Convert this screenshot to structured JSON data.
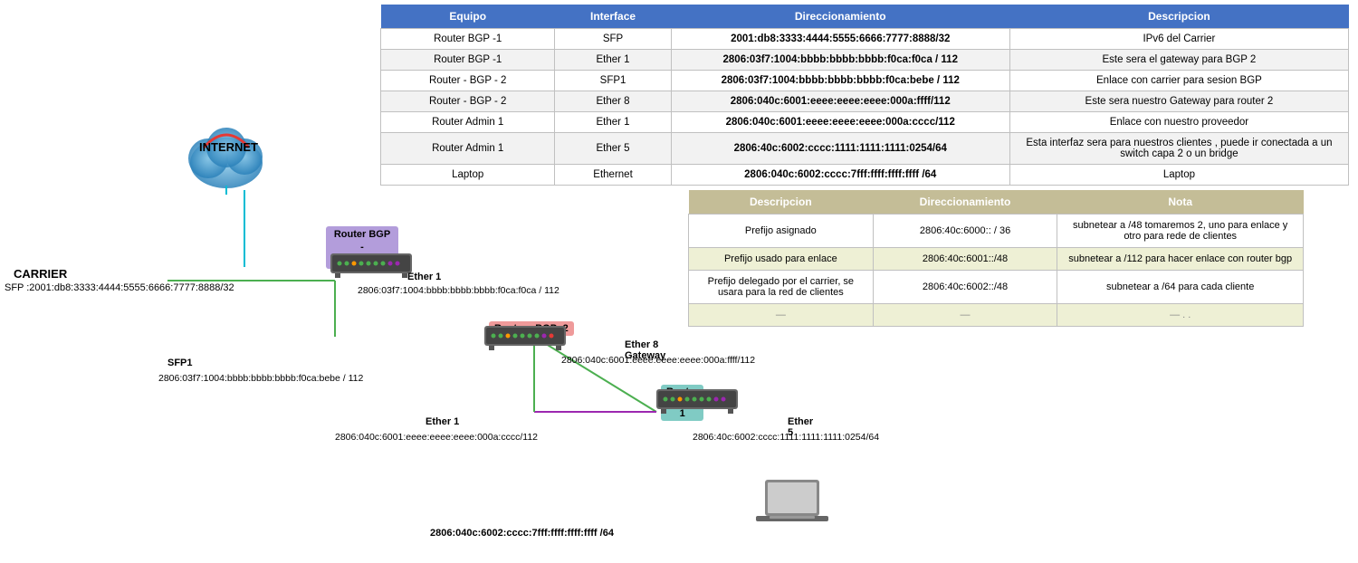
{
  "table": {
    "headers": [
      "Equipo",
      "Interface",
      "Direccionamiento",
      "Descripcion"
    ],
    "rows": [
      {
        "equipo": "Router BGP -1",
        "interface": "SFP",
        "direccionamiento": "2001:db8:3333:4444:5555:6666:7777:8888/32",
        "descripcion": "IPv6 del Carrier"
      },
      {
        "equipo": "Router BGP -1",
        "interface": "Ether 1",
        "direccionamiento": "2806:03f7:1004:bbbb:bbbb:bbbb:f0ca:f0ca / 112",
        "descripcion": "Este sera el gateway para BGP 2"
      },
      {
        "equipo": "Router - BGP - 2",
        "interface": "SFP1",
        "direccionamiento": "2806:03f7:1004:bbbb:bbbb:bbbb:f0ca:bebe / 112",
        "descripcion": "Enlace con carrier para sesion BGP"
      },
      {
        "equipo": "Router - BGP - 2",
        "interface": "Ether 8",
        "direccionamiento": "2806:040c:6001:eeee:eeee:eeee:000a:ffff/112",
        "descripcion": "Este sera nuestro Gateway para router 2"
      },
      {
        "equipo": "Router Admin 1",
        "interface": "Ether 1",
        "direccionamiento": "2806:040c:6001:eeee:eeee:eeee:000a:cccc/112",
        "descripcion": "Enlace con nuestro proveedor"
      },
      {
        "equipo": "Router Admin 1",
        "interface": "Ether 5",
        "direccionamiento": "2806:40c:6002:cccc:1111:1111:1111:0254/64",
        "descripcion": "Esta interfaz sera para nuestros clientes , puede ir conectada a un switch capa 2 o un bridge"
      },
      {
        "equipo": "Laptop",
        "interface": "Ethernet",
        "direccionamiento": "2806:040c:6002:cccc:7fff:ffff:ffff:ffff /64",
        "descripcion": "Laptop"
      }
    ]
  },
  "subtable": {
    "headers": [
      "Descripcion",
      "Direccionamiento",
      "Nota"
    ],
    "rows": [
      {
        "desc": "Prefijo asignado",
        "dir": "2806:40c:6000:: / 36",
        "nota": "subnetear a /48  tomaremos 2, uno para enlace y otro para rede de clientes"
      },
      {
        "desc": "Prefijo usado para enlace",
        "dir": "2806:40c:6001::/48",
        "nota": "subnetear a /112 para hacer enlace con router bgp"
      },
      {
        "desc": "Prefijo delegado por el carrier, se usara para la red de clientes",
        "dir": "2806:40c:6002::/48",
        "nota": "subnetear a /64 para cada cliente"
      },
      {
        "desc": "—",
        "dir": "—",
        "nota": "— . ."
      }
    ]
  },
  "diagram": {
    "internet_label": "INTERNET",
    "carrier_label": "CARRIER",
    "carrier_addr": "SFP :2001:db8:3333:4444:5555:6666:7777:8888/32",
    "router_bgp1_label": "Router BGP -\n1",
    "router_bgp2_label": "Router - BGP -2",
    "router_admin1_label": "Router Admin 1",
    "ether1_bgp1_label": "Ether 1",
    "ether1_bgp1_addr": "2806:03f7:1004:bbbb:bbbb:bbbb:f0ca:f0ca / 112",
    "sfp1_label": "SFP1",
    "sfp1_addr": "2806:03f7:1004:bbbb:bbbb:bbbb:f0ca:bebe / 112",
    "ether8_label": "Ether 8 Gateway",
    "ether8_addr": "2806:040c:6001:eeee:eeee:eeee:000a:ffff/112",
    "ether1_admin_label": "Ether 1",
    "ether1_admin_addr": "2806:040c:6001:eeee:eeee:eeee:000a:cccc/112",
    "ether5_label": "Ether 5",
    "ether5_addr": "2806:40c:6002:cccc:1111:1111:1111:0254/64",
    "laptop_addr": "2806:040c:6002:cccc:7fff:ffff:ffff:ffff /64"
  }
}
